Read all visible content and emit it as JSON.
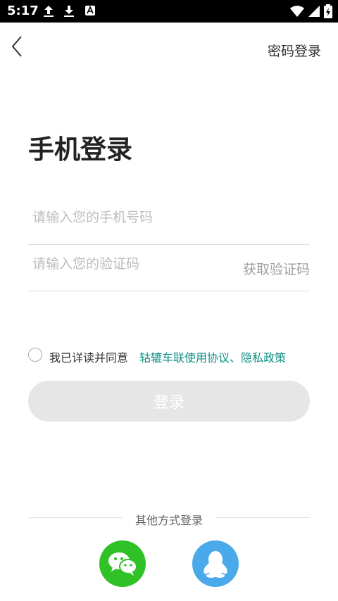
{
  "status_bar": {
    "time": "5:17"
  },
  "header": {
    "password_login": "密码登录"
  },
  "page": {
    "title": "手机登录"
  },
  "form": {
    "phone_placeholder": "请输入您的手机号码",
    "code_placeholder": "请输入您的验证码",
    "get_code": "获取验证码"
  },
  "agreement": {
    "prefix": "我已详读并同意",
    "link": "轱辘车联使用协议、隐私政策"
  },
  "login_button": "登录",
  "other_login": {
    "label": "其他方式登录",
    "icons": [
      "wechat-icon",
      "qq-icon"
    ]
  },
  "colors": {
    "link": "#0d8f84",
    "wechat": "#2fc125",
    "qq": "#4aa9ea",
    "button_disabled": "#e6e6e6"
  }
}
